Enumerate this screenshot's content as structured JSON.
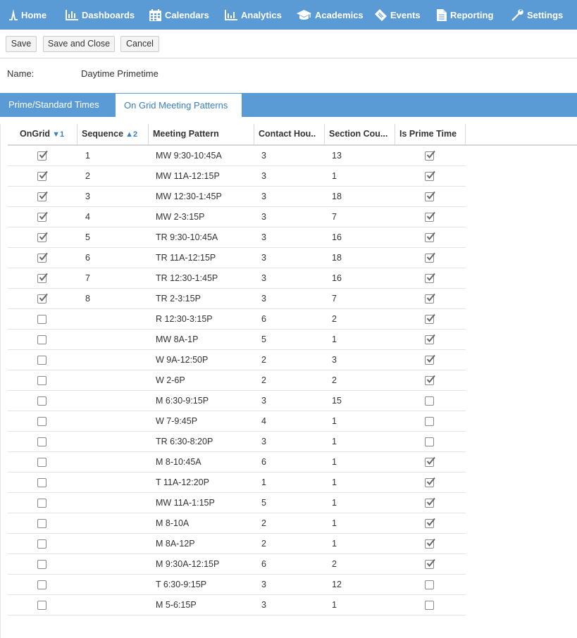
{
  "nav": {
    "items": [
      {
        "label": "Home",
        "icon": "home-icon"
      },
      {
        "label": "Dashboards",
        "icon": "bar-chart-icon"
      },
      {
        "label": "Calendars",
        "icon": "calendar-icon"
      },
      {
        "label": "Analytics",
        "icon": "analytics-icon"
      },
      {
        "label": "Academics",
        "icon": "graduation-cap-icon"
      },
      {
        "label": "Events",
        "icon": "ticket-icon"
      },
      {
        "label": "Reporting",
        "icon": "document-icon"
      },
      {
        "label": "Settings",
        "icon": "wrench-icon"
      }
    ]
  },
  "toolbar": {
    "save_label": "Save",
    "save_close_label": "Save and Close",
    "cancel_label": "Cancel"
  },
  "form": {
    "name_label": "Name:",
    "name_value": "Daytime Primetime"
  },
  "tabs": [
    {
      "label": "Prime/Standard Times",
      "active": false
    },
    {
      "label": "On Grid Meeting Patterns",
      "active": true
    }
  ],
  "grid": {
    "columns": [
      {
        "label": "OnGrid",
        "sort": "▼1"
      },
      {
        "label": "Sequence",
        "sort": "▲2"
      },
      {
        "label": "Meeting Pattern",
        "sort": ""
      },
      {
        "label": "Contact Hou..",
        "sort": ""
      },
      {
        "label": "Section Cou...",
        "sort": ""
      },
      {
        "label": "Is Prime Time",
        "sort": ""
      }
    ],
    "rows": [
      {
        "ongrid": true,
        "sequence": "1",
        "pattern": "MW 9:30-10:45A",
        "contact": "3",
        "sections": "13",
        "prime": true
      },
      {
        "ongrid": true,
        "sequence": "2",
        "pattern": "MW 11A-12:15P",
        "contact": "3",
        "sections": "1",
        "prime": true
      },
      {
        "ongrid": true,
        "sequence": "3",
        "pattern": "MW 12:30-1:45P",
        "contact": "3",
        "sections": "18",
        "prime": true
      },
      {
        "ongrid": true,
        "sequence": "4",
        "pattern": "MW 2-3:15P",
        "contact": "3",
        "sections": "7",
        "prime": true
      },
      {
        "ongrid": true,
        "sequence": "5",
        "pattern": "TR 9:30-10:45A",
        "contact": "3",
        "sections": "16",
        "prime": true
      },
      {
        "ongrid": true,
        "sequence": "6",
        "pattern": "TR 11A-12:15P",
        "contact": "3",
        "sections": "18",
        "prime": true
      },
      {
        "ongrid": true,
        "sequence": "7",
        "pattern": "TR 12:30-1:45P",
        "contact": "3",
        "sections": "16",
        "prime": true
      },
      {
        "ongrid": true,
        "sequence": "8",
        "pattern": "TR 2-3:15P",
        "contact": "3",
        "sections": "7",
        "prime": true
      },
      {
        "ongrid": false,
        "sequence": "",
        "pattern": "R 12:30-3:15P",
        "contact": "6",
        "sections": "2",
        "prime": true
      },
      {
        "ongrid": false,
        "sequence": "",
        "pattern": "MW 8A-1P",
        "contact": "5",
        "sections": "1",
        "prime": true
      },
      {
        "ongrid": false,
        "sequence": "",
        "pattern": "W 9A-12:50P",
        "contact": "2",
        "sections": "3",
        "prime": true
      },
      {
        "ongrid": false,
        "sequence": "",
        "pattern": "W 2-6P",
        "contact": "2",
        "sections": "2",
        "prime": true
      },
      {
        "ongrid": false,
        "sequence": "",
        "pattern": "M 6:30-9:15P",
        "contact": "3",
        "sections": "15",
        "prime": false
      },
      {
        "ongrid": false,
        "sequence": "",
        "pattern": "W 7-9:45P",
        "contact": "4",
        "sections": "1",
        "prime": false
      },
      {
        "ongrid": false,
        "sequence": "",
        "pattern": "TR 6:30-8:20P",
        "contact": "3",
        "sections": "1",
        "prime": false
      },
      {
        "ongrid": false,
        "sequence": "",
        "pattern": "M 8-10:45A",
        "contact": "6",
        "sections": "1",
        "prime": true
      },
      {
        "ongrid": false,
        "sequence": "",
        "pattern": "T 11A-12:20P",
        "contact": "1",
        "sections": "1",
        "prime": true
      },
      {
        "ongrid": false,
        "sequence": "",
        "pattern": "MW 11A-1:15P",
        "contact": "5",
        "sections": "1",
        "prime": true
      },
      {
        "ongrid": false,
        "sequence": "",
        "pattern": "M 8-10A",
        "contact": "2",
        "sections": "1",
        "prime": true
      },
      {
        "ongrid": false,
        "sequence": "",
        "pattern": "M 8A-12P",
        "contact": "2",
        "sections": "1",
        "prime": true
      },
      {
        "ongrid": false,
        "sequence": "",
        "pattern": "M 9:30A-12:15P",
        "contact": "6",
        "sections": "2",
        "prime": true
      },
      {
        "ongrid": false,
        "sequence": "",
        "pattern": "T 6:30-9:15P",
        "contact": "3",
        "sections": "12",
        "prime": false
      },
      {
        "ongrid": false,
        "sequence": "",
        "pattern": "M 5-6:15P",
        "contact": "3",
        "sections": "1",
        "prime": false
      }
    ]
  },
  "colors": {
    "nav_bg": "#5b9bd5",
    "active_tab_text": "#3a7fc1",
    "sort_indicator": "#3a7fc1"
  }
}
